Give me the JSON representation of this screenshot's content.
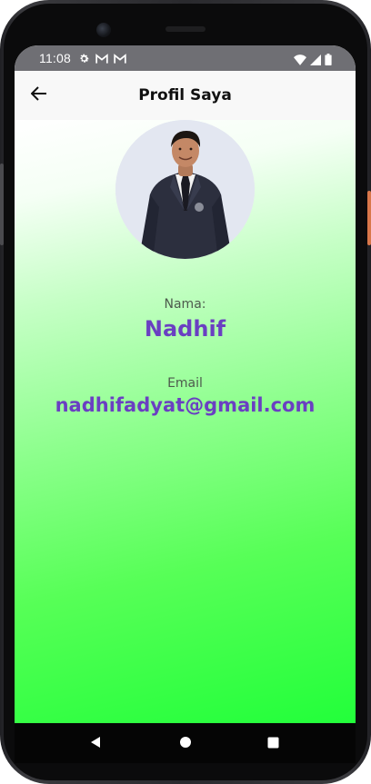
{
  "status_bar": {
    "time": "11:08",
    "left_icons": [
      "gear-icon",
      "gmail-icon",
      "gmail-icon"
    ],
    "right_icons": [
      "wifi-icon",
      "signal-icon",
      "battery-icon"
    ]
  },
  "app_bar": {
    "title": "Profil Saya",
    "back_icon": "arrow-left-icon"
  },
  "profile": {
    "name_label": "Nama:",
    "name_value": "Nadhif",
    "email_label": "Email",
    "email_value": "nadhifadyat@gmail.com"
  },
  "nav_bar": {
    "buttons": [
      "back-triangle-icon",
      "home-circle-icon",
      "recents-square-icon"
    ]
  },
  "colors": {
    "accent_text": "#6a3fc2",
    "gradient_start": "#ffffff",
    "gradient_end": "#22ff3a",
    "app_bar_bg": "#f8f8f8",
    "status_bar_bg": "#6f6f74"
  }
}
